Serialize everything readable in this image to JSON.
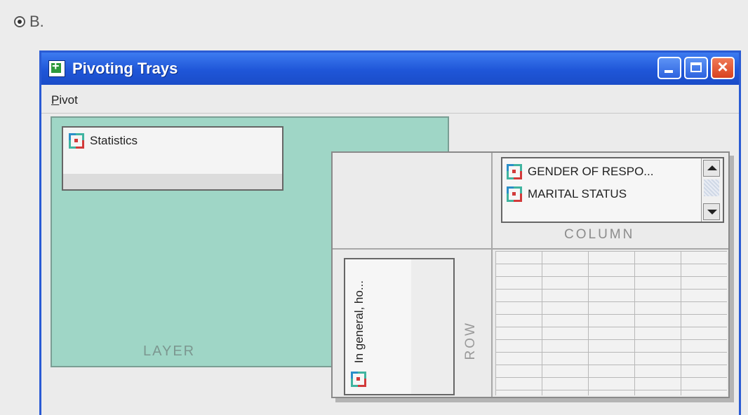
{
  "option": {
    "label": "B."
  },
  "window": {
    "title": "Pivoting Trays",
    "menu": {
      "pivot_accel": "P",
      "pivot_rest": "ivot"
    },
    "buttons": [
      "minimize",
      "maximize",
      "close"
    ]
  },
  "layer_tray": {
    "label": "LAYER",
    "items": [
      "Statistics"
    ]
  },
  "column_tray": {
    "label": "COLUMN",
    "items": [
      "GENDER OF RESPO...",
      "MARITAL STATUS"
    ]
  },
  "row_tray": {
    "label": "ROW",
    "items": [
      "In general, ho..."
    ]
  },
  "icons": {
    "tray_item": "pivot-variable-icon",
    "app": "pivot-table-icon"
  },
  "colors": {
    "titlebar": "#1f56d8",
    "layer_bg": "#9fd6c6",
    "close_button": "#d84220"
  }
}
